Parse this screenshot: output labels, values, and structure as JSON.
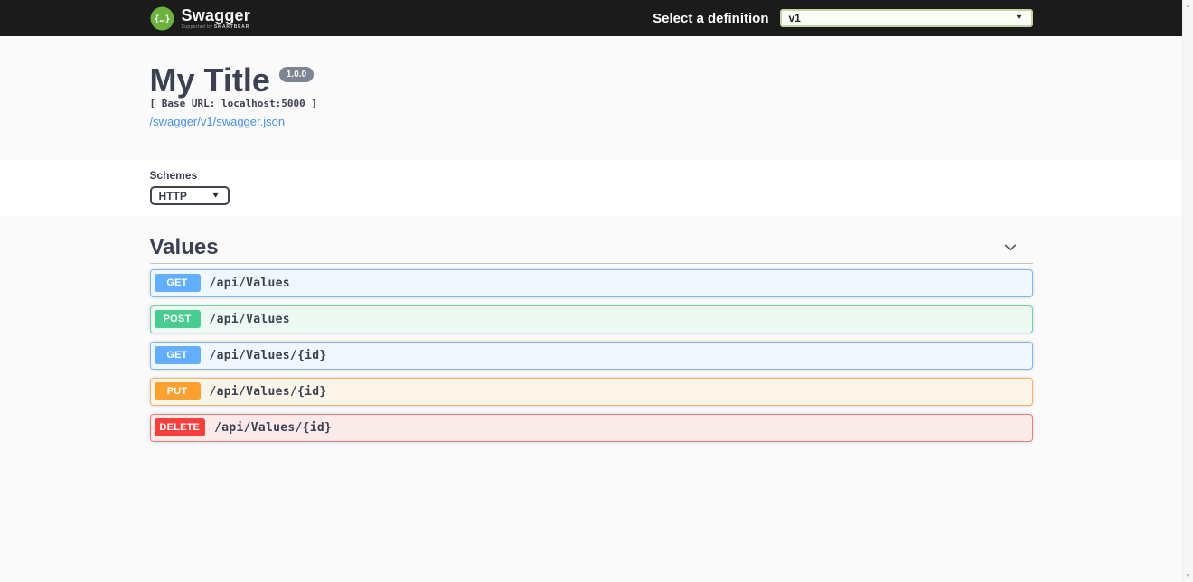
{
  "topbar": {
    "brand": "Swagger",
    "brand_subtitle_prefix": "Supported by",
    "brand_subtitle_name": "SMARTBEAR",
    "definition_label": "Select a definition",
    "definition_value": "v1"
  },
  "info": {
    "title": "My Title",
    "version": "1.0.0",
    "base_url": "[ Base URL: localhost:5000 ]",
    "spec_link": "/swagger/v1/swagger.json"
  },
  "schemes": {
    "label": "Schemes",
    "value": "HTTP"
  },
  "tag_section": {
    "title": "Values",
    "operations": [
      {
        "method": "GET",
        "path": "/api/Values"
      },
      {
        "method": "POST",
        "path": "/api/Values"
      },
      {
        "method": "GET",
        "path": "/api/Values/{id}"
      },
      {
        "method": "PUT",
        "path": "/api/Values/{id}"
      },
      {
        "method": "DELETE",
        "path": "/api/Values/{id}"
      }
    ]
  },
  "colors": {
    "topbar_bg": "#1b1b1b",
    "logo_green": "#6cb33e",
    "link_blue": "#4990e2",
    "text_primary": "#3b4151",
    "version_badge_bg": "#7d8492",
    "methods": {
      "GET": {
        "badge": "#61affe",
        "row_bg": "#f1f7fe",
        "row_border": "#7db9f0"
      },
      "POST": {
        "badge": "#49cc90",
        "row_bg": "#edfaf3",
        "row_border": "#6fd1a3"
      },
      "PUT": {
        "badge": "#fca130",
        "row_bg": "#fdf5ea",
        "row_border": "#f6b563"
      },
      "DELETE": {
        "badge": "#f93e3e",
        "row_bg": "#fbeaea",
        "row_border": "#ec7e7e"
      }
    }
  }
}
